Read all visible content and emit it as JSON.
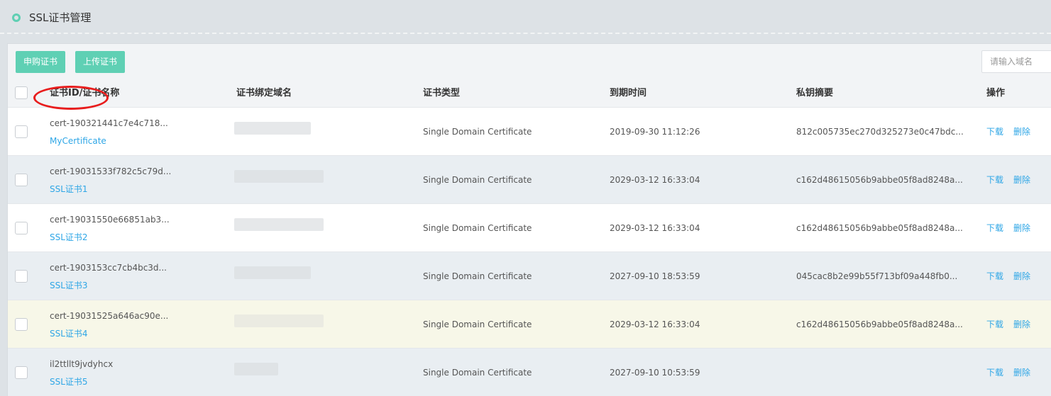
{
  "header": {
    "title": "SSL证书管理"
  },
  "toolbar": {
    "buy_label": "申购证书",
    "upload_label": "上传证书",
    "search_placeholder": "请输入域名"
  },
  "table": {
    "columns": [
      "证书ID/证书名称",
      "证书绑定域名",
      "证书类型",
      "到期时间",
      "私钥摘要",
      "操作"
    ],
    "action_download": "下载",
    "action_delete": "删除",
    "rows": [
      {
        "id": "cert-190321441c7e4c718...",
        "name": "MyCertificate",
        "type": "Single Domain Certificate",
        "expires": "2019-09-30 11:12:26",
        "key_digest": "812c005735ec270d325273e0c47bdc..."
      },
      {
        "id": "cert-19031533f782c5c79d...",
        "name": "SSL证书1",
        "type": "Single Domain Certificate",
        "expires": "2029-03-12 16:33:04",
        "key_digest": "c162d48615056b9abbe05f8ad8248a..."
      },
      {
        "id": "cert-19031550e66851ab3...",
        "name": "SSL证书2",
        "type": "Single Domain Certificate",
        "expires": "2029-03-12 16:33:04",
        "key_digest": "c162d48615056b9abbe05f8ad8248a..."
      },
      {
        "id": "cert-1903153cc7cb4bc3d...",
        "name": "SSL证书3",
        "type": "Single Domain Certificate",
        "expires": "2027-09-10 18:53:59",
        "key_digest": "045cac8b2e99b55f713bf09a448fb0..."
      },
      {
        "id": "cert-19031525a646ac90e...",
        "name": "SSL证书4",
        "type": "Single Domain Certificate",
        "expires": "2029-03-12 16:33:04",
        "key_digest": "c162d48615056b9abbe05f8ad8248a..."
      },
      {
        "id": "il2ttllt9jvdyhcx",
        "name": "SSL证书5",
        "type": "Single Domain Certificate",
        "expires": "2027-09-10 10:53:59",
        "key_digest": ""
      }
    ]
  },
  "colors": {
    "accent": "#5fd0b4",
    "link": "#2ea6e6",
    "annotation": "#e81d1d"
  }
}
